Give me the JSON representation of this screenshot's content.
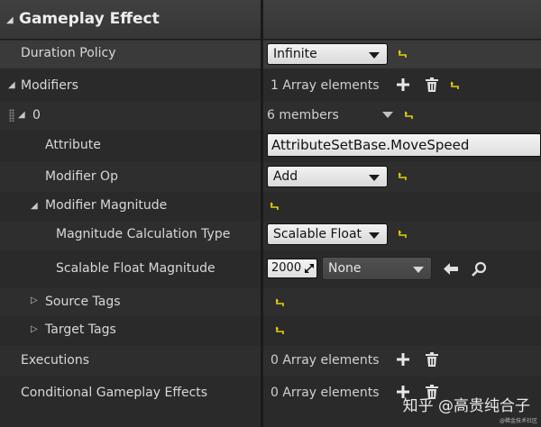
{
  "section": {
    "title": "Gameplay Effect"
  },
  "rows": {
    "duration_policy": {
      "label": "Duration Policy",
      "value": "Infinite"
    },
    "modifiers": {
      "label": "Modifiers",
      "summary": "1 Array elements"
    },
    "modifier_0": {
      "label": "0",
      "summary": "6 members"
    },
    "attribute": {
      "label": "Attribute",
      "value": "AttributeSetBase.MoveSpeed"
    },
    "modifier_op": {
      "label": "Modifier Op",
      "value": "Add"
    },
    "modifier_magnitude": {
      "label": "Modifier Magnitude"
    },
    "magnitude_calc_type": {
      "label": "Magnitude Calculation Type",
      "value": "Scalable Float"
    },
    "scalable_float": {
      "label": "Scalable Float Magnitude",
      "value": "2000",
      "curve_value": "None"
    },
    "source_tags": {
      "label": "Source Tags"
    },
    "target_tags": {
      "label": "Target Tags"
    },
    "executions": {
      "label": "Executions",
      "summary": "0 Array elements"
    },
    "conditional_effects": {
      "label": "Conditional Gameplay Effects",
      "summary": "0 Array elements"
    }
  },
  "watermark": {
    "text": "知乎 @高贵纯合子",
    "subtext": "@稀金技术社区"
  },
  "colors": {
    "reset_arrow": "#e8d20a",
    "panel_bg": "#2a2a2a",
    "header_bg": "#3b3b3b",
    "combo_bg": "#e6e6e6"
  }
}
